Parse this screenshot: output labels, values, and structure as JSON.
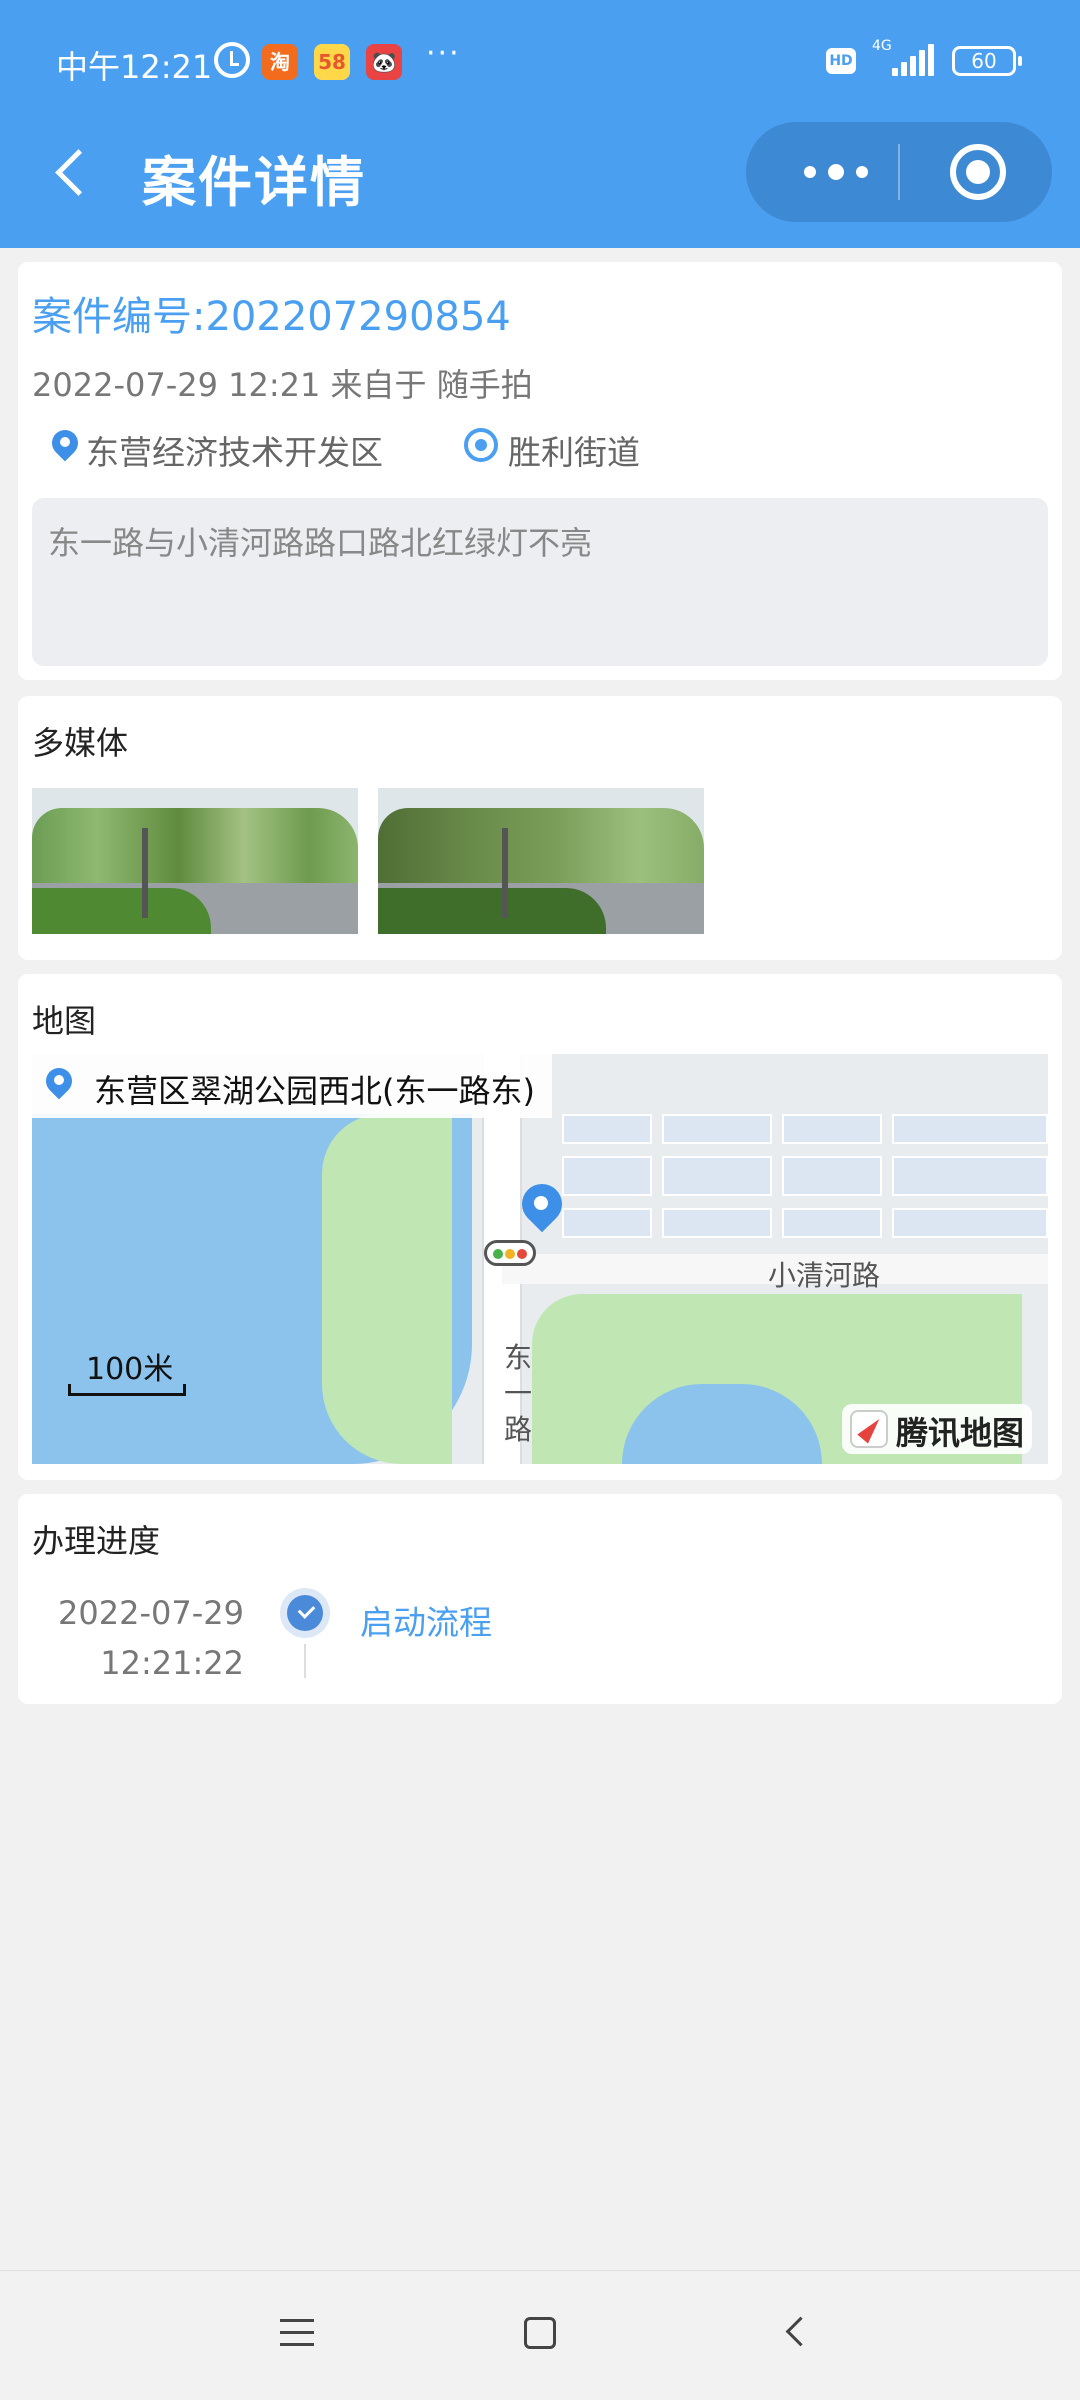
{
  "status_bar": {
    "time": "中午12:21",
    "more": "···",
    "hd": "HD",
    "network": "4G",
    "battery": "60",
    "apps": [
      "淘",
      "58",
      "🐼"
    ]
  },
  "nav": {
    "title": "案件详情"
  },
  "case": {
    "number_label": "案件编号:202207290854",
    "meta": "2022-07-29 12:21 来自于 随手拍",
    "district": "东营经济技术开发区",
    "street": "胜利街道",
    "description": "东一路与小清河路路口路北红绿灯不亮"
  },
  "media": {
    "title": "多媒体"
  },
  "map": {
    "title": "地图",
    "address": "东营区翠湖公园西北(东一路东)",
    "road_label_1": "小清河路",
    "road_label_2": "东",
    "road_label_3": "一",
    "road_label_4": "路",
    "scale": "100米",
    "brand": "腾讯地图"
  },
  "progress": {
    "title": "办理进度",
    "steps": [
      {
        "date": "2022-07-29",
        "time": "12:21:22",
        "label": "启动流程"
      }
    ]
  },
  "colors": {
    "accent": "#4a9ff0",
    "header": "#4a9ff0",
    "capsule": "#3d89d4"
  }
}
